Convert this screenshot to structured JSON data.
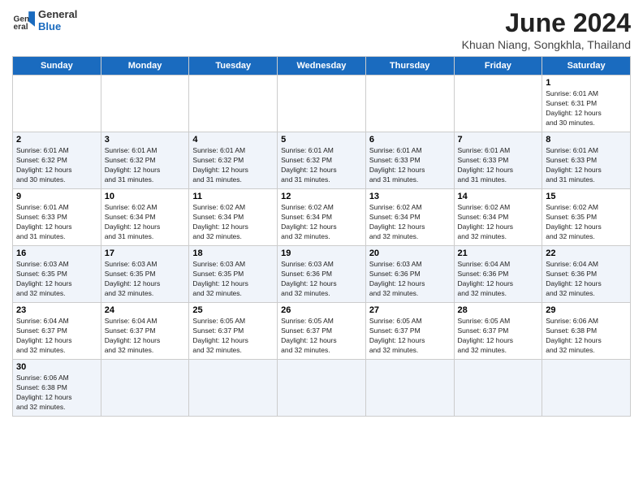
{
  "logo": {
    "line1": "General",
    "line2": "Blue"
  },
  "title": "June 2024",
  "subtitle": "Khuan Niang, Songkhla, Thailand",
  "days_of_week": [
    "Sunday",
    "Monday",
    "Tuesday",
    "Wednesday",
    "Thursday",
    "Friday",
    "Saturday"
  ],
  "weeks": [
    [
      {
        "day": "",
        "info": ""
      },
      {
        "day": "",
        "info": ""
      },
      {
        "day": "",
        "info": ""
      },
      {
        "day": "",
        "info": ""
      },
      {
        "day": "",
        "info": ""
      },
      {
        "day": "",
        "info": ""
      },
      {
        "day": "1",
        "info": "Sunrise: 6:01 AM\nSunset: 6:31 PM\nDaylight: 12 hours\nand 30 minutes."
      }
    ],
    [
      {
        "day": "2",
        "info": "Sunrise: 6:01 AM\nSunset: 6:32 PM\nDaylight: 12 hours\nand 30 minutes."
      },
      {
        "day": "3",
        "info": "Sunrise: 6:01 AM\nSunset: 6:32 PM\nDaylight: 12 hours\nand 31 minutes."
      },
      {
        "day": "4",
        "info": "Sunrise: 6:01 AM\nSunset: 6:32 PM\nDaylight: 12 hours\nand 31 minutes."
      },
      {
        "day": "5",
        "info": "Sunrise: 6:01 AM\nSunset: 6:32 PM\nDaylight: 12 hours\nand 31 minutes."
      },
      {
        "day": "6",
        "info": "Sunrise: 6:01 AM\nSunset: 6:33 PM\nDaylight: 12 hours\nand 31 minutes."
      },
      {
        "day": "7",
        "info": "Sunrise: 6:01 AM\nSunset: 6:33 PM\nDaylight: 12 hours\nand 31 minutes."
      },
      {
        "day": "8",
        "info": "Sunrise: 6:01 AM\nSunset: 6:33 PM\nDaylight: 12 hours\nand 31 minutes."
      }
    ],
    [
      {
        "day": "9",
        "info": "Sunrise: 6:01 AM\nSunset: 6:33 PM\nDaylight: 12 hours\nand 31 minutes."
      },
      {
        "day": "10",
        "info": "Sunrise: 6:02 AM\nSunset: 6:34 PM\nDaylight: 12 hours\nand 31 minutes."
      },
      {
        "day": "11",
        "info": "Sunrise: 6:02 AM\nSunset: 6:34 PM\nDaylight: 12 hours\nand 32 minutes."
      },
      {
        "day": "12",
        "info": "Sunrise: 6:02 AM\nSunset: 6:34 PM\nDaylight: 12 hours\nand 32 minutes."
      },
      {
        "day": "13",
        "info": "Sunrise: 6:02 AM\nSunset: 6:34 PM\nDaylight: 12 hours\nand 32 minutes."
      },
      {
        "day": "14",
        "info": "Sunrise: 6:02 AM\nSunset: 6:34 PM\nDaylight: 12 hours\nand 32 minutes."
      },
      {
        "day": "15",
        "info": "Sunrise: 6:02 AM\nSunset: 6:35 PM\nDaylight: 12 hours\nand 32 minutes."
      }
    ],
    [
      {
        "day": "16",
        "info": "Sunrise: 6:03 AM\nSunset: 6:35 PM\nDaylight: 12 hours\nand 32 minutes."
      },
      {
        "day": "17",
        "info": "Sunrise: 6:03 AM\nSunset: 6:35 PM\nDaylight: 12 hours\nand 32 minutes."
      },
      {
        "day": "18",
        "info": "Sunrise: 6:03 AM\nSunset: 6:35 PM\nDaylight: 12 hours\nand 32 minutes."
      },
      {
        "day": "19",
        "info": "Sunrise: 6:03 AM\nSunset: 6:36 PM\nDaylight: 12 hours\nand 32 minutes."
      },
      {
        "day": "20",
        "info": "Sunrise: 6:03 AM\nSunset: 6:36 PM\nDaylight: 12 hours\nand 32 minutes."
      },
      {
        "day": "21",
        "info": "Sunrise: 6:04 AM\nSunset: 6:36 PM\nDaylight: 12 hours\nand 32 minutes."
      },
      {
        "day": "22",
        "info": "Sunrise: 6:04 AM\nSunset: 6:36 PM\nDaylight: 12 hours\nand 32 minutes."
      }
    ],
    [
      {
        "day": "23",
        "info": "Sunrise: 6:04 AM\nSunset: 6:37 PM\nDaylight: 12 hours\nand 32 minutes."
      },
      {
        "day": "24",
        "info": "Sunrise: 6:04 AM\nSunset: 6:37 PM\nDaylight: 12 hours\nand 32 minutes."
      },
      {
        "day": "25",
        "info": "Sunrise: 6:05 AM\nSunset: 6:37 PM\nDaylight: 12 hours\nand 32 minutes."
      },
      {
        "day": "26",
        "info": "Sunrise: 6:05 AM\nSunset: 6:37 PM\nDaylight: 12 hours\nand 32 minutes."
      },
      {
        "day": "27",
        "info": "Sunrise: 6:05 AM\nSunset: 6:37 PM\nDaylight: 12 hours\nand 32 minutes."
      },
      {
        "day": "28",
        "info": "Sunrise: 6:05 AM\nSunset: 6:37 PM\nDaylight: 12 hours\nand 32 minutes."
      },
      {
        "day": "29",
        "info": "Sunrise: 6:06 AM\nSunset: 6:38 PM\nDaylight: 12 hours\nand 32 minutes."
      }
    ],
    [
      {
        "day": "30",
        "info": "Sunrise: 6:06 AM\nSunset: 6:38 PM\nDaylight: 12 hours\nand 32 minutes."
      },
      {
        "day": "",
        "info": ""
      },
      {
        "day": "",
        "info": ""
      },
      {
        "day": "",
        "info": ""
      },
      {
        "day": "",
        "info": ""
      },
      {
        "day": "",
        "info": ""
      },
      {
        "day": "",
        "info": ""
      }
    ]
  ]
}
